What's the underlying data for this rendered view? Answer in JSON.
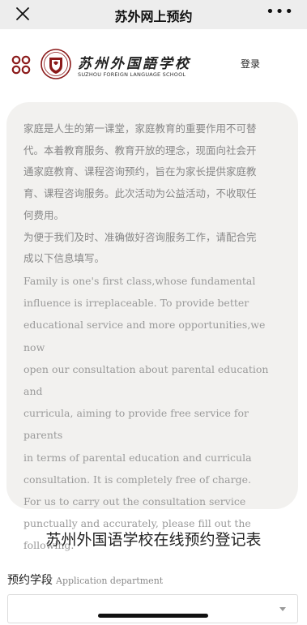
{
  "topbar": {
    "title": "苏外网上预约",
    "more_icon": "more-dots-icon",
    "close_icon": "close-icon"
  },
  "header": {
    "menu_icon": "grid-menu-icon",
    "logo_icon": "school-emblem-icon",
    "school_name_cn": "苏州外国語学校",
    "school_name_en": "SUZHOU FOREIGN LANGUAGE SCHOOL",
    "login_label": "登录"
  },
  "intro": {
    "cn_lines": [
      "家庭是人生的第一课堂，家庭教育的重要作用不可替",
      "代。本着教育服务、教育开放的理念，现面向社会开",
      "通家庭教育、课程咨询预约，旨在为家长提供家庭教",
      "育、课程咨询服务。此次活动为公益活动，不收取任",
      "何费用。",
      "为便于我们及时、准确做好咨询服务工作，请配合完",
      "成以下信息填写。"
    ],
    "en_lines": [
      "Family is one's first class,whose fundamental",
      "influence is irreplaceable. To provide better",
      "educational service and more opportunities,we now",
      "open our consultation about parental education and",
      "curricula, aiming to provide free service for parents",
      "in terms of parental education and curricula",
      "consultation. It is completely free of charge.",
      "For us to carry out the consultation service",
      "punctually and accurately, please fill out the",
      "following."
    ]
  },
  "form": {
    "title": "苏州外国语学校在线预约登记表",
    "department_label_cn": "预约学段",
    "department_label_en": "Application department",
    "department_value": ""
  },
  "colors": {
    "card_bg": "#f2f1ef",
    "emblem_red": "#8b1a1a"
  }
}
